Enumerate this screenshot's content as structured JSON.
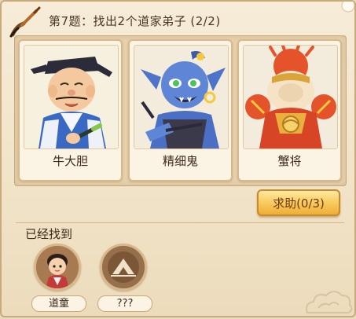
{
  "header": {
    "title": "第7题：找出2个道家弟子 (2/2)"
  },
  "cards": [
    {
      "name": "牛大胆",
      "portrait": "scholar-character-portrait"
    },
    {
      "name": "精细鬼",
      "portrait": "blue-imp-character-portrait"
    },
    {
      "name": "蟹将",
      "portrait": "crab-general-character-portrait"
    }
  ],
  "help_button": {
    "label": "求助(0/3)"
  },
  "found": {
    "label": "已经找到",
    "slots": [
      {
        "name": "道童",
        "state": "found"
      },
      {
        "name": "???",
        "state": "unknown"
      }
    ]
  },
  "colors": {
    "panel_bg": "#f1e3c8",
    "border": "#c9aa7a",
    "button_gold": "#f7c85a",
    "text_dark": "#3b2a1a"
  }
}
